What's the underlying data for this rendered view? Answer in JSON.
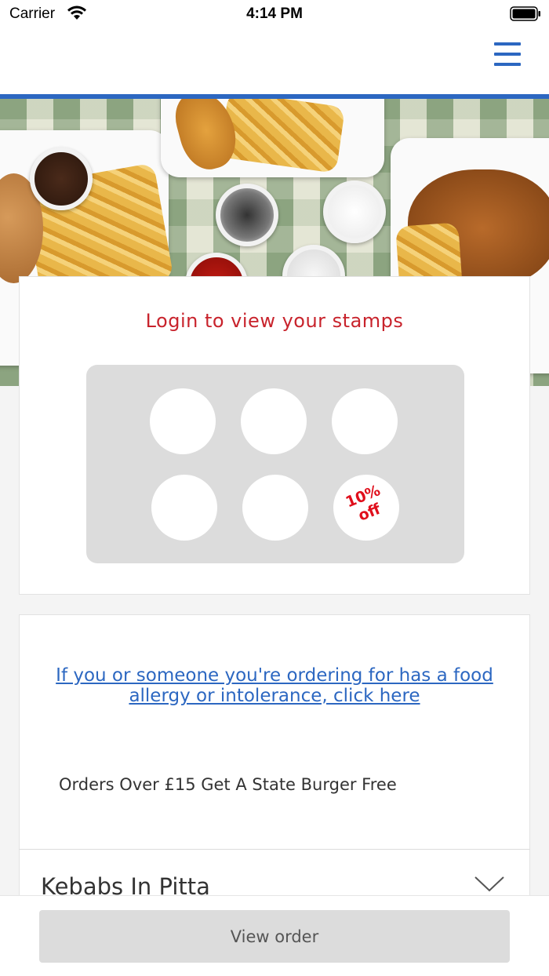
{
  "status_bar": {
    "carrier": "Carrier",
    "time": "4:14 PM"
  },
  "header": {
    "menu_icon": "hamburger-menu-icon",
    "accent_color": "#2c67c1"
  },
  "stamps_card": {
    "title": "Login to view your stamps",
    "stamps_total": 6,
    "stamps_collected": 0,
    "reward_label": "10%\noff",
    "reward_color": "#e00f1c"
  },
  "info": {
    "allergy_link": "If you or someone you're ordering for has a food allergy or intolerance, click here",
    "promo_text": "Orders Over £15 Get A State Burger Free"
  },
  "menu": {
    "categories": [
      {
        "label": "Kebabs In Pitta",
        "icon": "chevron-down-icon"
      }
    ]
  },
  "footer": {
    "view_order_label": "View order"
  }
}
